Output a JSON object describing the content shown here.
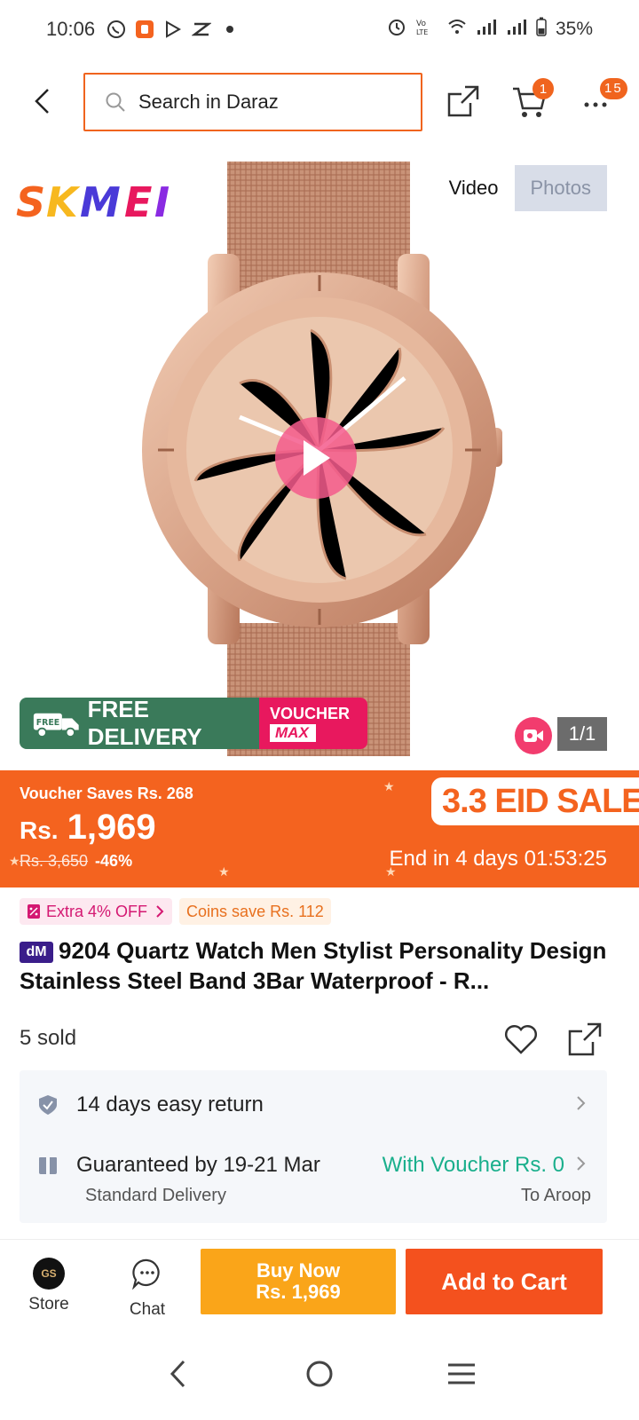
{
  "status_bar": {
    "time": "10:06",
    "battery": "35%"
  },
  "header": {
    "search_placeholder": "Search in Daraz",
    "cart_badge": "1",
    "more_badge": "15"
  },
  "gallery": {
    "brand": "SKMEI",
    "tabs": [
      "Video",
      "Photos"
    ],
    "active_tab": "Photos",
    "promo_free_delivery": "FREE DELIVERY",
    "promo_free_small": "FREE",
    "promo_voucher": "VOUCHER",
    "promo_voucher_max": "MAX",
    "counter": "1/1"
  },
  "price_banner": {
    "voucher_saves": "Voucher Saves Rs. 268",
    "currency": "Rs.",
    "price": "1,969",
    "original_price": "Rs. 3,650",
    "discount": "-46%",
    "sale_label": "3.3 EID SALE",
    "countdown": "End in 4 days 01:53:25"
  },
  "tags": {
    "extra_off": "Extra 4% OFF",
    "coins_save": "Coins save Rs. 112"
  },
  "product": {
    "dm_label": "dM",
    "title": "9204 Quartz Watch Men Stylist Personality Design Stainless Steel Band 3Bar Waterproof - R...",
    "sold": "5 sold"
  },
  "info": {
    "return": "14 days easy return",
    "delivery_guarantee": "Guaranteed by 19-21 Mar",
    "delivery_voucher": "With Voucher Rs. 0",
    "delivery_type": "Standard Delivery",
    "delivery_to": "To Aroop"
  },
  "bottom_bar": {
    "store_label": "Store",
    "store_avatar": "GS",
    "chat_label": "Chat",
    "buy_now_label": "Buy Now",
    "buy_now_price": "Rs. 1,969",
    "add_to_cart_label": "Add to Cart"
  },
  "colors": {
    "accent": "#f4631f",
    "buy_now": "#faa519",
    "voucher_green": "#1aaf8c"
  }
}
